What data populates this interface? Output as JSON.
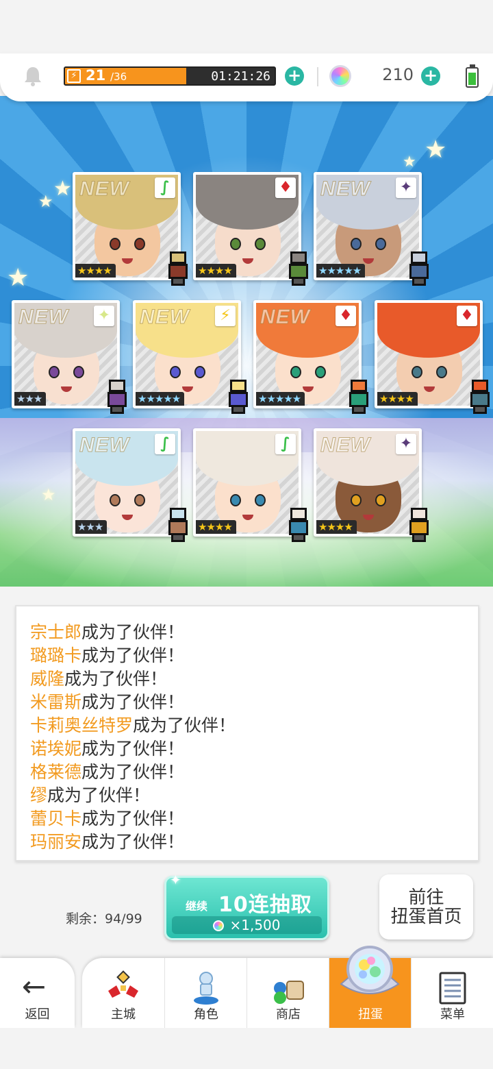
{
  "status_bar": {
    "stamina_current": "21",
    "stamina_max": "/36",
    "stamina_fraction": 0.58,
    "timer": "01:21:26",
    "gems": "210",
    "add_symbol": "+",
    "icons": [
      "bell-icon",
      "lightning-icon",
      "plus-icon",
      "rainbow-gem-icon",
      "battery-icon"
    ]
  },
  "cards": [
    {
      "new": true,
      "element": "wind",
      "stars": 4,
      "rarity_text": "★★★★"
    },
    {
      "new": false,
      "element": "fire",
      "stars": 4,
      "rarity_text": "★★★★"
    },
    {
      "new": true,
      "element": "dark",
      "stars": 5,
      "rarity_text": "★★★★★"
    },
    {
      "new": true,
      "element": "light",
      "stars": 3,
      "rarity_text": "★★★"
    },
    {
      "new": true,
      "element": "thunder",
      "stars": 5,
      "rarity_text": "★★★★★"
    },
    {
      "new": true,
      "element": "fire",
      "stars": 5,
      "rarity_text": "★★★★★"
    },
    {
      "new": false,
      "element": "fire",
      "stars": 4,
      "rarity_text": "★★★★"
    },
    {
      "new": true,
      "element": "wind",
      "stars": 3,
      "rarity_text": "★★★"
    },
    {
      "new": false,
      "element": "wind",
      "stars": 4,
      "rarity_text": "★★★★"
    },
    {
      "new": true,
      "element": "dark",
      "stars": 4,
      "rarity_text": "★★★★"
    }
  ],
  "new_label": "NEW",
  "results": {
    "suffix": "成为了伙伴！",
    "names": [
      "宗士郎",
      "璐璐卡",
      "威隆",
      "米雷斯",
      "卡莉奥丝特罗",
      "诺埃妮",
      "格莱德",
      "缪",
      "蕾贝卡",
      "玛丽安"
    ]
  },
  "draw": {
    "remaining": "剩余：94/99",
    "continue_label": "继续",
    "button_label": "10连抽取",
    "cost": "×1,500",
    "goto_line1": "前往",
    "goto_line2": "扭蛋首页"
  },
  "nav": {
    "back": "返回",
    "tabs": [
      {
        "label": "主城",
        "icon": "castle-icon"
      },
      {
        "label": "角色",
        "icon": "character-icon"
      },
      {
        "label": "商店",
        "icon": "shop-icon"
      },
      {
        "label": "扭蛋",
        "icon": "gacha-machine-icon",
        "active": true
      },
      {
        "label": "菜单",
        "icon": "menu-icon"
      }
    ]
  },
  "colors": {
    "accent_orange": "#f7941d",
    "teal": "#2ab7a3",
    "name_orange": "#f29a1f"
  }
}
